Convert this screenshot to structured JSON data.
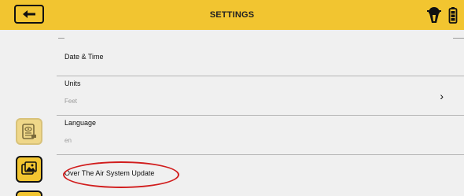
{
  "header": {
    "title": "SETTINGS",
    "back_icon": "back-arrow-icon",
    "icons": [
      "antenna-satellite-icon",
      "battery-icon"
    ]
  },
  "rail": {
    "icons": [
      "document-view-icon",
      "image-gallery-icon",
      "rail-partial-icon"
    ]
  },
  "settings": {
    "date_time": {
      "label": "Date & Time"
    },
    "units": {
      "label": "Units",
      "value": "Feet",
      "chevron_icon": "chevron-right-icon"
    },
    "language": {
      "label": "Language",
      "value": "en"
    },
    "ota": {
      "label": "Over The Air System Update"
    }
  },
  "colors": {
    "accent_yellow": "#f2c530",
    "highlight_ring": "#d11d1d",
    "background": "#f0f0f0"
  }
}
